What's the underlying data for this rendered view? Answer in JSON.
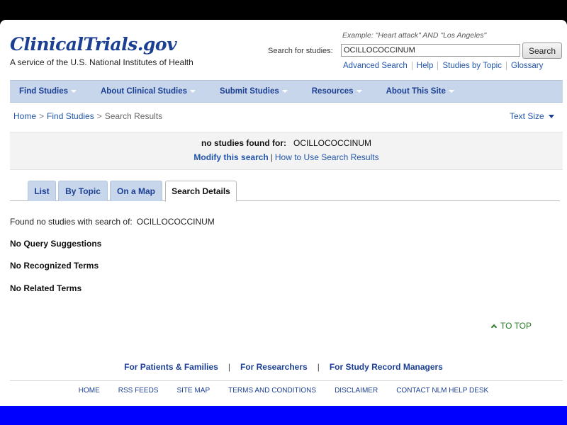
{
  "header": {
    "logo": "ClinicalTrials.gov",
    "tagline": "A service of the U.S. National Institutes of Health",
    "example": "Example: \"Heart attack\" AND \"Los Angeles\"",
    "search_label": "Search for studies:",
    "search_value": "OCILLOCOCCINUM",
    "search_button": "Search",
    "quicklinks": [
      "Advanced Search",
      "Help",
      "Studies by Topic",
      "Glossary"
    ]
  },
  "nav": {
    "items": [
      "Find Studies",
      "About Clinical Studies",
      "Submit Studies",
      "Resources",
      "About This Site"
    ]
  },
  "breadcrumb": {
    "home": "Home",
    "find": "Find Studies",
    "current": "Search Results",
    "separator": ">"
  },
  "text_size": "Text Size",
  "notice": {
    "label": "no studies found for:",
    "term": "OCILLOCOCCINUM",
    "modify": "Modify this search",
    "divider": "|",
    "howto": "How to Use Search Results"
  },
  "tabs": [
    "List",
    "By Topic",
    "On a Map",
    "Search Details"
  ],
  "details": {
    "found_label": "Found no studies with search of:",
    "found_term": "OCILLOCOCCINUM",
    "no_query": "No Query Suggestions",
    "no_recognized": "No Recognized Terms",
    "no_related": "No Related Terms"
  },
  "to_top": "TO TOP",
  "footer": {
    "audiences": [
      "For Patients & Families",
      "For Researchers",
      "For Study Record Managers"
    ],
    "pipe": "|",
    "links": [
      "HOME",
      "RSS FEEDS",
      "SITE MAP",
      "TERMS AND CONDITIONS",
      "DISCLAIMER",
      "CONTACT NLM HELP DESK"
    ]
  },
  "colors": {
    "brand_blue": "#1c3f94",
    "link_blue": "#2255aa",
    "nav_bg": "#c7d6ea",
    "to_top_green": "#2a7a2a",
    "slide_blue_band": "#0000ff"
  }
}
